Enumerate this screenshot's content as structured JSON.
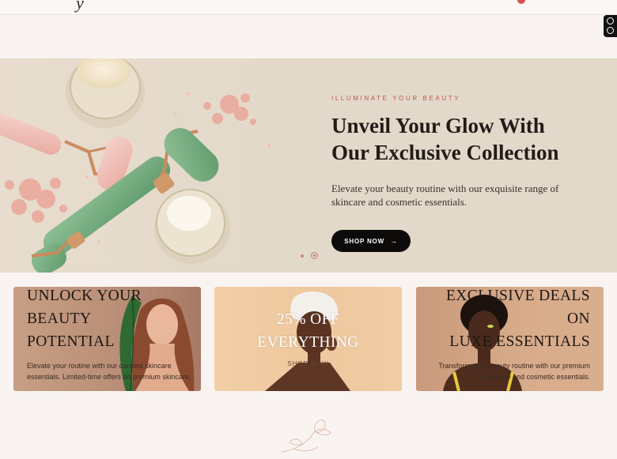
{
  "header": {
    "logo_fragment": "y"
  },
  "hero": {
    "eyebrow": "ILLUMINATE YOUR BEAUTY",
    "title_line1": "Unveil Your Glow With",
    "title_line2": "Our Exclusive Collection",
    "description": "Elevate your beauty routine with our exquisite range of skincare and cosmetic essentials.",
    "cta_label": "SHOP NOW",
    "cta_icon": "arrow-right-icon",
    "slides_total": 2,
    "active_slide": 2
  },
  "promos": [
    {
      "title_lines": [
        "UNLOCK YOUR",
        "BEAUTY",
        "POTENTIAL"
      ],
      "description": "Elevate your routine with our curated skincare essentials. Limited-time offers on premium skincare."
    },
    {
      "title_lines": [
        "25% OFF",
        "EVERYTHING"
      ],
      "link_label": "SHOP NOW"
    },
    {
      "title_lines": [
        "EXCLUSIVE DEALS",
        "ON",
        "LUXE ESSENTIALS"
      ],
      "description": "Transform your beauty routine with our premium skincare and cosmetic essentials."
    }
  ],
  "colors": {
    "accent": "#c0564a",
    "button": "#0d0b0a",
    "page_background": "#f9f4f2"
  }
}
